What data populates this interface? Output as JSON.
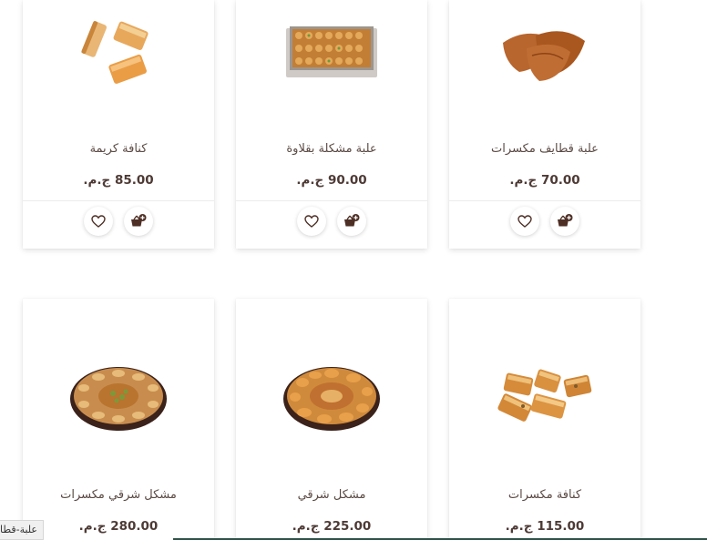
{
  "currency": "ج.م.",
  "products": [
    {
      "name": "كنافة كريمة",
      "price": "85.00",
      "image": "konafa-cream"
    },
    {
      "name": "علبة مشكلة بقلاوة",
      "price": "90.00",
      "image": "baklava-box"
    },
    {
      "name": "علبة قطايف مكسرات",
      "price": "70.00",
      "image": "qatayef"
    },
    {
      "name": "مشكل شرقي مكسرات",
      "price": "280.00",
      "image": "oriental-tray-nuts"
    },
    {
      "name": "مشكل شرقي",
      "price": "225.00",
      "image": "oriental-tray"
    },
    {
      "name": "كنافة مكسرات",
      "price": "115.00",
      "image": "konafa-nuts"
    }
  ],
  "icons": {
    "wishlist": "heart-icon",
    "cart": "add-to-cart-icon"
  },
  "status_url": "علبة-قطايف-مكسرات",
  "colors": {
    "icon": "#4e2f25",
    "text": "#5b4a44",
    "price": "#4e3a35"
  }
}
